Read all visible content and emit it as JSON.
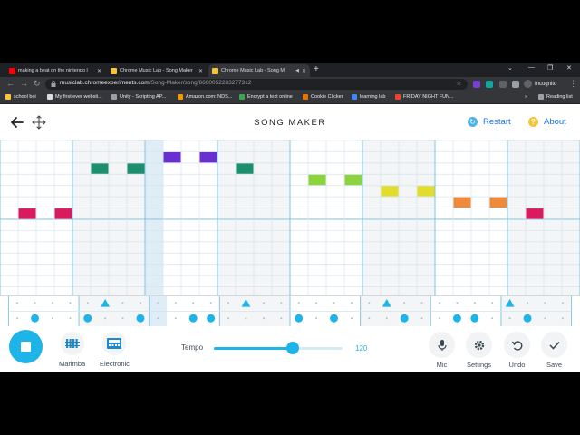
{
  "browser": {
    "tabs": [
      {
        "title": "making a beat on the nintendo l",
        "favicon_color": "#ff0000",
        "active": false
      },
      {
        "title": "Chrome Music Lab - Song Maker",
        "favicon_color": "#f6c33d",
        "active": false
      },
      {
        "title": "Chrome Music Lab - Song M",
        "favicon_color": "#f6c33d",
        "active": true
      }
    ],
    "new_tab_label": "+",
    "address": {
      "domain": "musiclab.chromeexperiments.com",
      "path": "/Song-Maker/song/6600052283277312"
    },
    "profile_label": "Incognito",
    "bookmarks": [
      {
        "label": "school boi",
        "color": "#f6c33d"
      },
      {
        "label": "My first ever websit...",
        "color": "#dadce0"
      },
      {
        "label": "Unity - Scripting AP...",
        "color": "#9aa0a6"
      },
      {
        "label": "Amazon.com: NDS...",
        "color": "#f29900"
      },
      {
        "label": "Encrypt a text online",
        "color": "#34a853"
      },
      {
        "label": "Cookie Clicker",
        "color": "#e37400"
      },
      {
        "label": "learning lab",
        "color": "#4285f4"
      },
      {
        "label": "FRIDAY NIGHT FUN...",
        "color": "#ea4335"
      }
    ],
    "bookmarks_overflow": "»",
    "reading_list_label": "Reading list"
  },
  "app": {
    "title": "SONG MAKER",
    "restart_label": "Restart",
    "about_label": "About",
    "instruments": [
      {
        "label": "Marimba"
      },
      {
        "label": "Electronic"
      }
    ],
    "tempo": {
      "label": "Tempo",
      "value": "120",
      "fraction": 0.61
    },
    "right_buttons": [
      {
        "label": "Mic",
        "icon": "mic-icon"
      },
      {
        "label": "Settings",
        "icon": "gear-icon"
      },
      {
        "label": "Undo",
        "icon": "undo-icon"
      },
      {
        "label": "Save",
        "icon": "check-icon"
      }
    ]
  },
  "song": {
    "columns": 32,
    "rows": 14,
    "highlighted_column": 8,
    "notes": [
      {
        "col": 1,
        "row": 6,
        "color": "#d81b5c"
      },
      {
        "col": 3,
        "row": 6,
        "color": "#d81b5c"
      },
      {
        "col": 5,
        "row": 2,
        "color": "#1e8f6e"
      },
      {
        "col": 7,
        "row": 2,
        "color": "#1e8f6e"
      },
      {
        "col": 9,
        "row": 1,
        "color": "#6a2fd1"
      },
      {
        "col": 11,
        "row": 1,
        "color": "#6a2fd1"
      },
      {
        "col": 13,
        "row": 2,
        "color": "#1e8f6e"
      },
      {
        "col": 17,
        "row": 3,
        "color": "#8cd43e"
      },
      {
        "col": 19,
        "row": 3,
        "color": "#8cd43e"
      },
      {
        "col": 21,
        "row": 4,
        "color": "#e2dc2a"
      },
      {
        "col": 23,
        "row": 4,
        "color": "#e2dc2a"
      },
      {
        "col": 25,
        "row": 5,
        "color": "#ee8a3a"
      },
      {
        "col": 27,
        "row": 5,
        "color": "#ee8a3a"
      },
      {
        "col": 29,
        "row": 6,
        "color": "#d81b5c"
      }
    ],
    "triangles": [
      5,
      13,
      21,
      28
    ],
    "circles": [
      1,
      4,
      7,
      10,
      11,
      16,
      18,
      22,
      25,
      26,
      29
    ]
  },
  "colors": {
    "accent": "#1eb4e8",
    "grid_line": "#d4e4ee",
    "measure_line": "#7fc6e6"
  }
}
